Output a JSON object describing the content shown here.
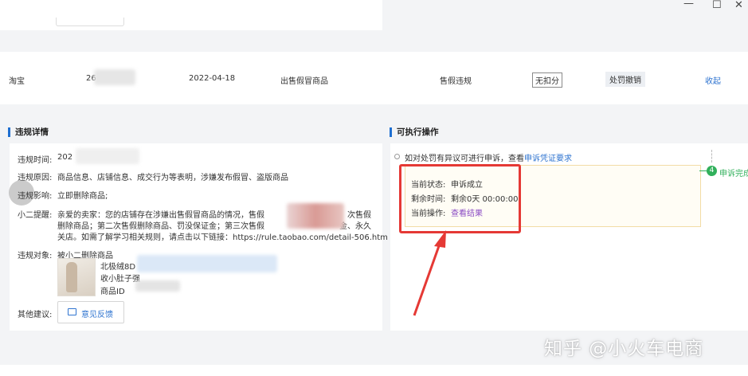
{
  "window": {
    "minimize": "—",
    "maximize": "☐",
    "close": "✕"
  },
  "record": {
    "platform": "淘宝",
    "id": "26",
    "date": "2022-04-18",
    "reason": "出售假冒商品",
    "type": "售假违规",
    "deduct_tag": "无扣分",
    "penalty_tag": "处罚撤销",
    "collapse": "收起"
  },
  "details": {
    "title": "违规详情",
    "time_label": "违规时间:",
    "time_value": "202",
    "reason_label": "违规原因:",
    "reason_value": "商品信息、店铺信息、成交行为等表明，涉嫌发布假冒、盗版商品",
    "impact_label": "违规影响:",
    "impact_value": "立即删除商品;",
    "reminder_label": "小二提醒:",
    "reminder_line1_a": "亲爱的卖家：您的店铺存在涉嫌出售假冒商品的情况，售假",
    "reminder_line1_b": "次售假",
    "reminder_line2_a": "删除商品；第二次售假删除商品、罚没保证金；第三次售假",
    "reminder_line2_b": "金、永久",
    "reminder_line3": "关店。如需了解学习相关规则，请点击以下链接：https://rule.taobao.com/detail-506.htm",
    "target_label": "违规对象:",
    "target_value": "被小二删除商品",
    "product_name1": "北极绒8D",
    "product_name2": "收小肚子强",
    "product_id_label": "商品ID",
    "other_label": "其他建议:",
    "feedback_button": "意见反馈"
  },
  "actions": {
    "title": "可执行操作",
    "step_text": "如对处罚有异议可进行申诉，查看",
    "step_link": "申诉凭证要求",
    "status_label": "当前状态:",
    "status_value": "申诉成立",
    "remain_label": "剩余时间:",
    "remain_value": "剩余0天 00:00:00",
    "op_label": "当前操作:",
    "op_link": "查看结果",
    "step4_num": "4",
    "step4_label": "申诉完成"
  },
  "watermark": "知乎 @小火车电商",
  "colors": {
    "accent": "#1f6fd1",
    "link": "#2f74d0",
    "success": "#31b05b",
    "highlight": "#e53935"
  }
}
